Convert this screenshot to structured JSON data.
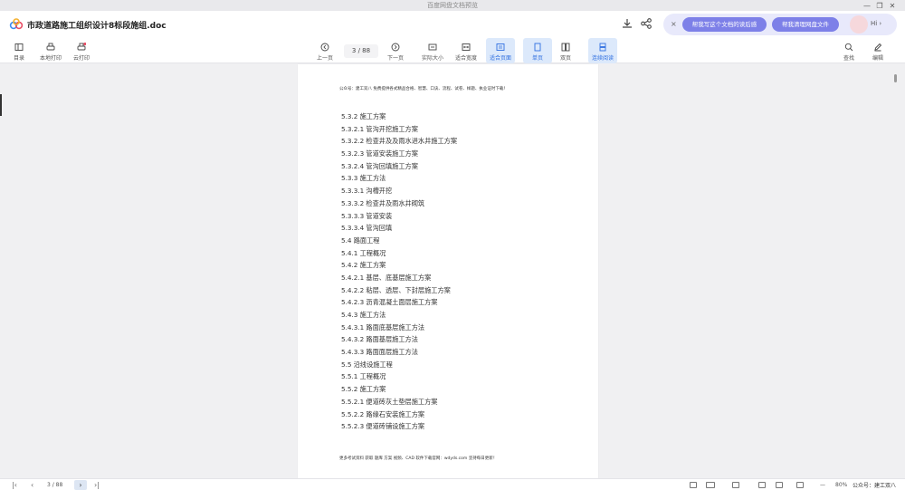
{
  "window": {
    "app_title": "百度网盘文档预览",
    "controls": [
      "—",
      "❐",
      "✕"
    ]
  },
  "header": {
    "doc_title": "市政道路施工组织设计8标段施组.doc",
    "ai_pills": [
      "帮我写这个文档的读后感",
      "帮我清理网盘文件"
    ],
    "hi_text": "Hi ›",
    "ai_close": "×"
  },
  "toolbar": {
    "left": [
      {
        "label": "目录",
        "icon": "outline-icon"
      },
      {
        "label": "本地打印",
        "icon": "print-icon"
      },
      {
        "label": "云打印",
        "icon": "cloud-print-icon"
      }
    ],
    "prev_label": "上一页",
    "page_indicator": "3 / 88",
    "next_label": "下一页",
    "view": [
      {
        "label": "实际大小",
        "icon": "actual-size-icon",
        "active": false
      },
      {
        "label": "适合宽度",
        "icon": "fit-width-icon",
        "active": false
      },
      {
        "label": "适合页面",
        "icon": "fit-page-icon",
        "active": true
      },
      {
        "label": "单页",
        "icon": "single-page-icon",
        "active": true
      },
      {
        "label": "双页",
        "icon": "double-page-icon",
        "active": false
      },
      {
        "label": "连续阅读",
        "icon": "continuous-icon",
        "active": true
      }
    ],
    "right": [
      {
        "label": "查找",
        "icon": "search-icon"
      },
      {
        "label": "编辑",
        "icon": "edit-icon"
      }
    ]
  },
  "document": {
    "header_text": "公众号：建工双八 免费提供各式精品合格、智慧、口诀、流程、试卷、样题、执业证时下载！",
    "toc": [
      "5.3.2  施工方案",
      "5.3.2.1 管沟开挖施工方案",
      "5.3.2.2 检查井及及雨水进水井施工方案",
      "5.3.2.3 管道安装施工方案",
      "5.3.2.4 管沟回填施工方案",
      "5.3.3  施工方法",
      "5.3.3.1 沟槽开挖",
      "5.3.3.2 检查井及雨水井砌筑",
      "5.3.3.3 管道安装",
      "5.3.3.4 管沟回填",
      "5.4 路面工程",
      "5.4.1 工程概况",
      "5.4.2 施工方案",
      "5.4.2.1 基层、底基层施工方案",
      "5.4.2.2 粘层、透层、下封层施工方案",
      "5.4.2.3 沥青混凝土面层施工方案",
      "5.4.3 施工方法",
      "5.4.3.1 路面底基层施工方法",
      "5.4.3.2 路面基层施工方法",
      "5.4.3.3 路面面层施工方法",
      "5.5 沿线设施工程",
      "5.5.1 工程概况",
      "5.5.2 施工方案",
      "5.5.2.1 便道砖灰土垫层施工方案",
      "5.5.2.2 路缘石安装施工方案",
      "5.5.2.3 便道砖铺设施工方案"
    ],
    "footer_text": "更多考试资料 获取 题库 方案 视频、CAD 软件下载官网：wdyds.com 坚持每日更新！"
  },
  "statusbar": {
    "first": "|‹",
    "prev": "‹",
    "page_indicator": "3 / 88",
    "next": "›",
    "last": "›|",
    "zoom_minus": "—",
    "zoom": "80%",
    "zoom_plus": "+",
    "watermark": "公众号：建工双八"
  },
  "colors": {
    "accent": "#2f6fe0",
    "ai_pill": "#7d80e8",
    "ai_bar": "#e8e9fb",
    "background": "#f0f0f2"
  }
}
